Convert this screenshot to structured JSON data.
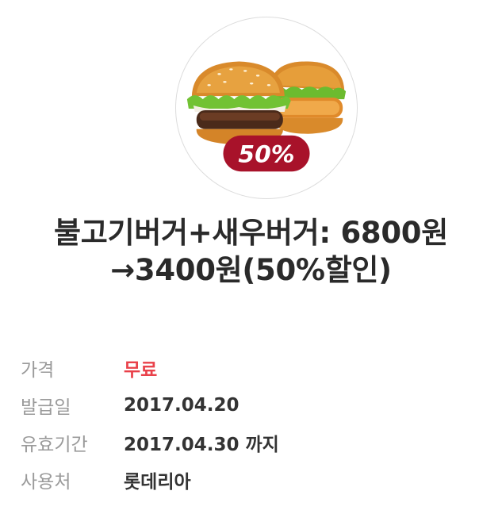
{
  "coupon": {
    "badge_text": "50%",
    "badge_color": "#a8122a",
    "title_line1": "불고기버거+새우버거: 6800원",
    "title_line2": "→3400원(50%할인)"
  },
  "details": [
    {
      "label": "가격",
      "value": "무료",
      "highlight": "#e9414a"
    },
    {
      "label": "발급일",
      "value": "2017.04.20"
    },
    {
      "label": "유효기간",
      "value": "2017.04.30 까지"
    },
    {
      "label": "사용처",
      "value": "롯데리아"
    }
  ]
}
